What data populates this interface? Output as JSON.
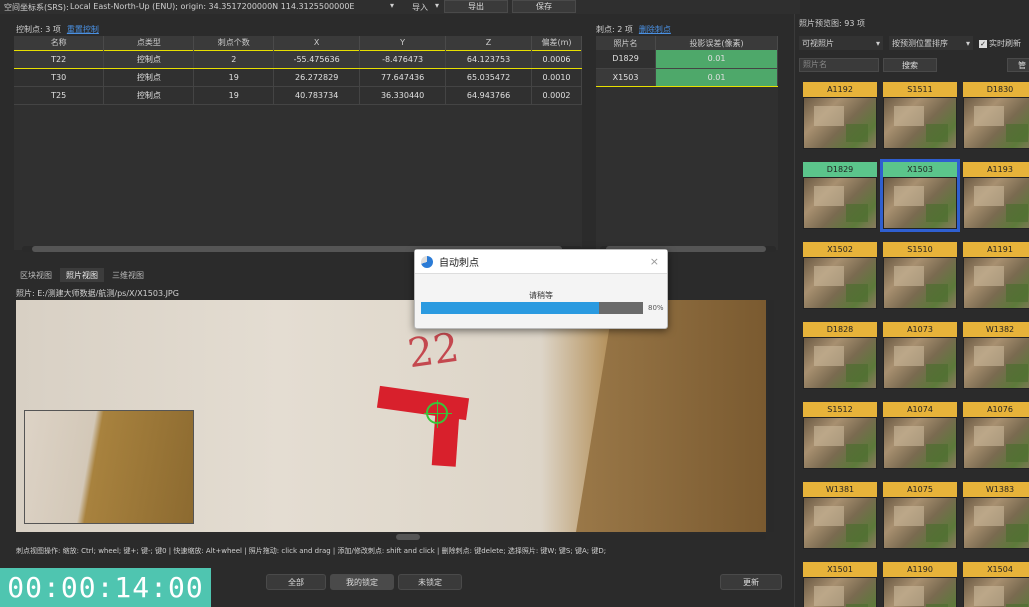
{
  "topbar": {
    "srs_label": "空间坐标系(SRS):",
    "srs_value": "Local East-North-Up (ENU); origin: 34.3517200000N 114.3125500000E",
    "import_label": "导入",
    "export_label": "导出",
    "save_label": "保存"
  },
  "control_points": {
    "header": "控制点: 3 项",
    "link": "重置控制",
    "columns": [
      "名称",
      "点类型",
      "刺点个数",
      "X",
      "Y",
      "Z",
      "偏差(m)"
    ],
    "rows": [
      [
        "T22",
        "控制点",
        "2",
        "-55.475636",
        "-8.476473",
        "64.123753",
        "0.0006"
      ],
      [
        "T30",
        "控制点",
        "19",
        "26.272829",
        "77.647436",
        "65.035472",
        "0.0010"
      ],
      [
        "T25",
        "控制点",
        "19",
        "40.783734",
        "36.330440",
        "64.943766",
        "0.0002"
      ]
    ]
  },
  "marks": {
    "header": "刺点: 2 项",
    "link": "删除刺点",
    "columns": [
      "照片名",
      "投影误差(像素)"
    ],
    "rows": [
      [
        "D1829",
        "0.01"
      ],
      [
        "X1503",
        "0.01"
      ]
    ]
  },
  "view_tabs": [
    "区块视图",
    "照片视图",
    "三维视图"
  ],
  "photo_path": "照片:  E:/测建大师数据/航测/ps/X/X1503.JPG",
  "image_marks": {
    "digits": "22"
  },
  "help_text": "刺点视图操作: 缩放: Ctrl; wheel; 键+; 键-; 键0 | 快速缩放: Alt+wheel | 照片拖动: click and drag | 添加/修改刺点: shift and click | 删除刺点: 键delete; 选择照片: 键W; 键S; 键A; 键D;",
  "bottom_buttons": {
    "all": "全部",
    "mine": "我的锁定",
    "unlocked": "未锁定",
    "update": "更新"
  },
  "timer": "00:00:14:00",
  "dialog": {
    "title": "自动刺点",
    "status": "请稍等",
    "progress_percent": 80,
    "progress_text": "80%",
    "close": "×"
  },
  "right_panel": {
    "header": "照片预览图: 93 项",
    "filter_select": "可视照片",
    "sort_select": "按预测位置排序",
    "realtime_label": "实时刷新",
    "search_placeholder": "照片名",
    "search_button": "搜索",
    "extra_button": "管",
    "thumbnails": [
      {
        "name": "A1192",
        "color": "yellow"
      },
      {
        "name": "S1511",
        "color": "yellow"
      },
      {
        "name": "D1830",
        "color": "yellow"
      },
      {
        "name": "D1829",
        "color": "green"
      },
      {
        "name": "X1503",
        "color": "green",
        "selected": true
      },
      {
        "name": "A1193",
        "color": "yellow"
      },
      {
        "name": "X1502",
        "color": "yellow"
      },
      {
        "name": "S1510",
        "color": "yellow"
      },
      {
        "name": "A1191",
        "color": "yellow"
      },
      {
        "name": "D1828",
        "color": "yellow"
      },
      {
        "name": "A1073",
        "color": "yellow"
      },
      {
        "name": "W1382",
        "color": "yellow"
      },
      {
        "name": "S1512",
        "color": "yellow"
      },
      {
        "name": "A1074",
        "color": "yellow"
      },
      {
        "name": "A1076",
        "color": "yellow"
      },
      {
        "name": "W1381",
        "color": "yellow"
      },
      {
        "name": "A1075",
        "color": "yellow"
      },
      {
        "name": "W1383",
        "color": "yellow"
      },
      {
        "name": "X1501",
        "color": "yellow"
      },
      {
        "name": "A1190",
        "color": "yellow"
      },
      {
        "name": "X1504",
        "color": "yellow"
      }
    ]
  }
}
